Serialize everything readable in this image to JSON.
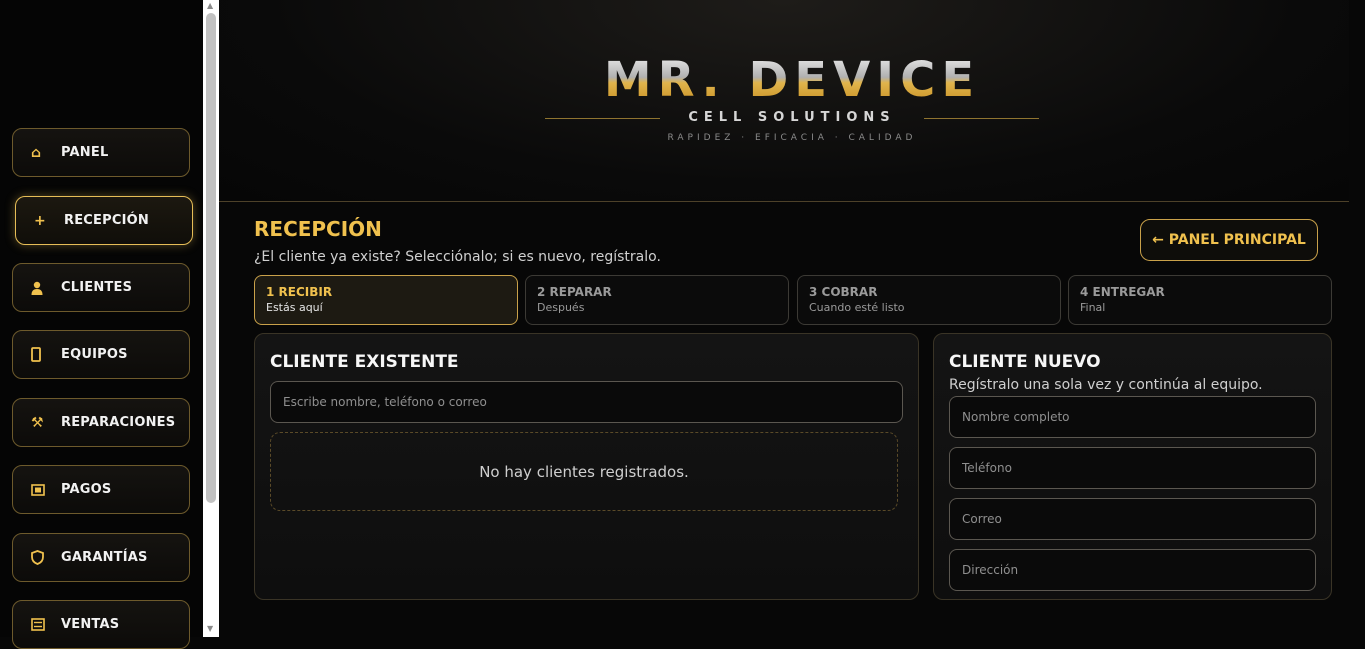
{
  "sidebar": {
    "items": [
      {
        "label": "PANEL",
        "icon": "home-icon",
        "glyph": "⌂"
      },
      {
        "label": "RECEPCIÓN",
        "icon": "plus-icon",
        "glyph": "+"
      },
      {
        "label": "CLIENTES",
        "icon": "user-icon",
        "glyph": "👤"
      },
      {
        "label": "EQUIPOS",
        "icon": "phone-icon",
        "glyph": "▯"
      },
      {
        "label": "REPARACIONES",
        "icon": "tools-icon",
        "glyph": "⚒"
      },
      {
        "label": "PAGOS",
        "icon": "payment-icon",
        "glyph": "▣"
      },
      {
        "label": "GARANTÍAS",
        "icon": "shield-icon",
        "glyph": "⛉"
      },
      {
        "label": "VENTAS",
        "icon": "list-icon",
        "glyph": "▤"
      }
    ],
    "active_index": 1
  },
  "header": {
    "title": "MR. DEVICE",
    "subtitle": "CELL SOLUTIONS",
    "tagline": "RAPIDEZ · EFICACIA · CALIDAD"
  },
  "page": {
    "title": "RECEPCIÓN",
    "subtitle": "¿El cliente ya existe? Selecciónalo; si es nuevo, regístralo.",
    "back_button": "← PANEL PRINCIPAL"
  },
  "steps": [
    {
      "title": "1 RECIBIR",
      "sub": "Estás aquí",
      "active": true
    },
    {
      "title": "2 REPARAR",
      "sub": "Después",
      "active": false
    },
    {
      "title": "3 COBRAR",
      "sub": "Cuando esté listo",
      "active": false
    },
    {
      "title": "4 ENTREGAR",
      "sub": "Final",
      "active": false
    }
  ],
  "existing_client": {
    "title": "CLIENTE EXISTENTE",
    "search_placeholder": "Escribe nombre, teléfono o correo",
    "empty_message": "No hay clientes registrados."
  },
  "new_client": {
    "title": "CLIENTE NUEVO",
    "subtitle": "Regístralo una sola vez y continúa al equipo.",
    "name_placeholder": "Nombre completo",
    "phone_placeholder": "Teléfono",
    "email_placeholder": "Correo",
    "address_placeholder": "Dirección"
  },
  "colors": {
    "accent": "#f0c14e",
    "border_gold": "#c9a14a",
    "background": "#070707"
  }
}
